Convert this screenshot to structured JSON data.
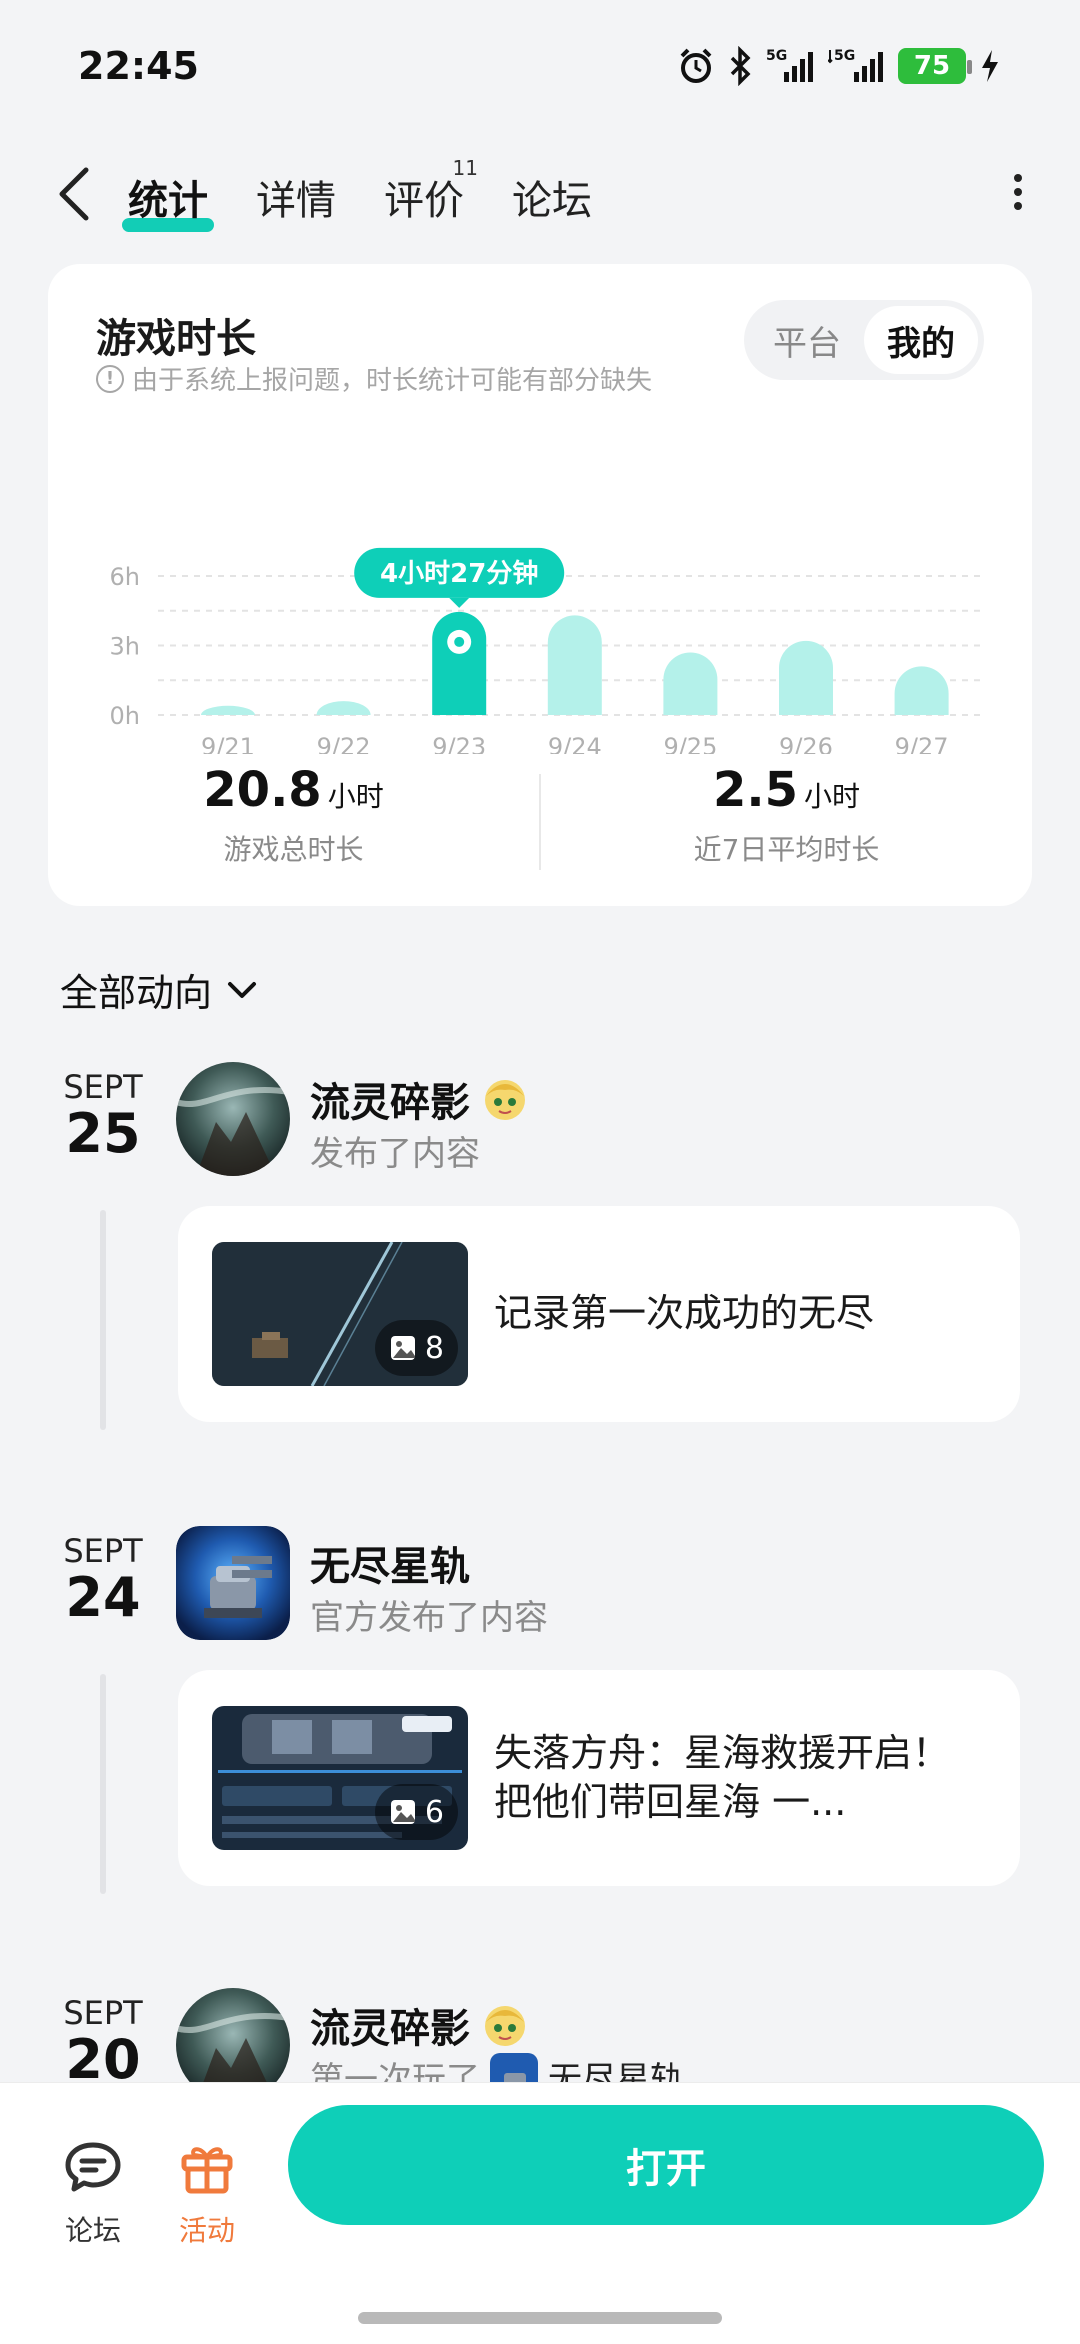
{
  "status_bar": {
    "time": "22:45",
    "battery": "75",
    "icons": [
      "alarm-icon",
      "bluetooth-icon",
      "5g-signal-icon",
      "5g-signal-icon",
      "battery-icon",
      "charging-icon"
    ]
  },
  "nav": {
    "tabs": [
      {
        "label": "统计",
        "active": true
      },
      {
        "label": "详情"
      },
      {
        "label": "评价",
        "badge": "11"
      },
      {
        "label": "论坛"
      }
    ]
  },
  "stats": {
    "title": "游戏时长",
    "note": "由于系统上报问题，时长统计可能有部分缺失",
    "toggle": [
      "平台",
      "我的"
    ],
    "toggle_active": "我的",
    "tooltip": "4小时27分钟",
    "total_value": "20.8",
    "total_unit": "小时",
    "total_label": "游戏总时长",
    "avg_value": "2.5",
    "avg_unit": "小时",
    "avg_label": "近7日平均时长"
  },
  "chart_data": {
    "type": "bar",
    "categories": [
      "9/21",
      "9/22",
      "9/23",
      "9/24",
      "9/25",
      "9/26",
      "9/27"
    ],
    "values": [
      0.4,
      0.6,
      4.45,
      4.3,
      2.7,
      3.2,
      2.1
    ],
    "highlight_index": 2,
    "ylim": [
      0,
      6
    ],
    "yticks": [
      "6h",
      "3h",
      "0h"
    ],
    "ytick_values": [
      6,
      3,
      0
    ],
    "grid": true,
    "colors": {
      "bar": "#b4f1ea",
      "highlight": "#0ecfb8"
    }
  },
  "filter": {
    "label": "全部动向"
  },
  "feed": [
    {
      "month": "SEPT",
      "day": "25",
      "name": "流灵碎影",
      "action": "发布了内容",
      "post_text": "记录第一次成功的无尽",
      "image_count": "8"
    },
    {
      "month": "SEPT",
      "day": "24",
      "name": "无尽星轨",
      "action": "官方发布了内容",
      "post_text": "失落方舟：星海救援开启！把他们带回星海 一...",
      "image_count": "6"
    },
    {
      "month": "SEPT",
      "day": "20",
      "name": "流灵碎影",
      "action": "第一次玩了",
      "game": "无尽星轨"
    }
  ],
  "bottom_bar": {
    "forum_label": "论坛",
    "activity_label": "活动",
    "open_label": "打开",
    "accent": "#0ecfb8",
    "activity_color": "#f07a3c"
  }
}
